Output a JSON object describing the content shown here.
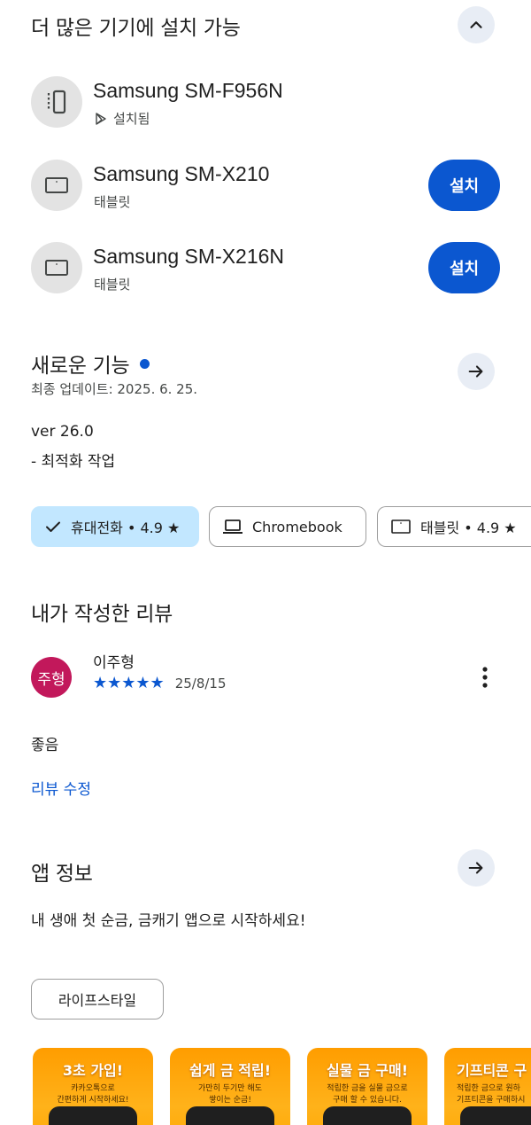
{
  "devices_section": {
    "title": "더 많은 기기에 설치 가능",
    "collapse_icon": "chevron-up-icon",
    "devices": [
      {
        "name": "Samsung SM-F956N",
        "status": "설치됨",
        "icon": "foldable-phone-icon",
        "installed": true
      },
      {
        "name": "Samsung SM-X210",
        "status": "태블릿",
        "icon": "tablet-icon",
        "installed": false,
        "button": "설치"
      },
      {
        "name": "Samsung SM-X216N",
        "status": "태블릿",
        "icon": "tablet-icon",
        "installed": false,
        "button": "설치"
      }
    ]
  },
  "whats_new": {
    "title": "새로운 기능",
    "updated": "최종 업데이트: 2025. 6. 25.",
    "version": "ver 26.0",
    "notes": "- 최적화 작업",
    "dot_color": "#0b57d0"
  },
  "device_chips": [
    {
      "label": "휴대전화 • 4.9 ★",
      "icon": "check-icon",
      "selected": true
    },
    {
      "label": "Chromebook",
      "icon": "laptop-icon",
      "selected": false
    },
    {
      "label": "태블릿 • 4.9 ★",
      "icon": "tablet-icon",
      "selected": false
    }
  ],
  "my_review": {
    "title": "내가 작성한 리뷰",
    "avatar_text": "주형",
    "avatar_color": "#c2185b",
    "author": "이주형",
    "rating": 5,
    "stars": "★★★★★",
    "date": "25/8/15",
    "text": "좋음",
    "edit_link": "리뷰 수정"
  },
  "app_info": {
    "title": "앱 정보",
    "description": "내 생애 첫 순금, 금캐기 앱으로 시작하세요!",
    "category": "라이프스타일"
  },
  "screenshots": [
    {
      "headline": "3초 가입!",
      "sub": "카카오톡으로\n간편하게 시작하세요!"
    },
    {
      "headline": "쉽게 금 적립!",
      "sub": "가만히 두기만 해도\n쌓이는 순금!"
    },
    {
      "headline": "실물 금 구매!",
      "sub": "적립한 금을 실물 금으로\n구매 할 수 있습니다."
    },
    {
      "headline": "기프티콘 구",
      "sub": "적립한 금으로 원하\n기프티콘을 구매하시"
    }
  ],
  "colors": {
    "accent": "#0b57d0",
    "chip_selected": "#c2e7ff",
    "round_button": "#e8edf5"
  }
}
